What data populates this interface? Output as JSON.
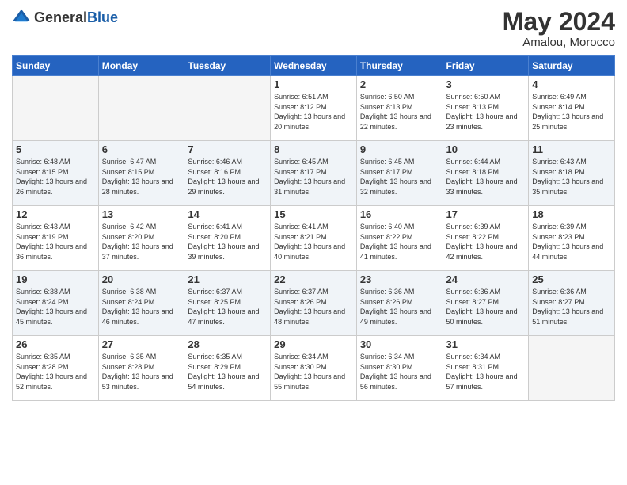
{
  "logo": {
    "general": "General",
    "blue": "Blue"
  },
  "title": {
    "month_year": "May 2024",
    "location": "Amalou, Morocco"
  },
  "weekdays": [
    "Sunday",
    "Monday",
    "Tuesday",
    "Wednesday",
    "Thursday",
    "Friday",
    "Saturday"
  ],
  "weeks": [
    [
      {
        "day": "",
        "info": ""
      },
      {
        "day": "",
        "info": ""
      },
      {
        "day": "",
        "info": ""
      },
      {
        "day": "1",
        "info": "Sunrise: 6:51 AM\nSunset: 8:12 PM\nDaylight: 13 hours and 20 minutes."
      },
      {
        "day": "2",
        "info": "Sunrise: 6:50 AM\nSunset: 8:13 PM\nDaylight: 13 hours and 22 minutes."
      },
      {
        "day": "3",
        "info": "Sunrise: 6:50 AM\nSunset: 8:13 PM\nDaylight: 13 hours and 23 minutes."
      },
      {
        "day": "4",
        "info": "Sunrise: 6:49 AM\nSunset: 8:14 PM\nDaylight: 13 hours and 25 minutes."
      }
    ],
    [
      {
        "day": "5",
        "info": "Sunrise: 6:48 AM\nSunset: 8:15 PM\nDaylight: 13 hours and 26 minutes."
      },
      {
        "day": "6",
        "info": "Sunrise: 6:47 AM\nSunset: 8:15 PM\nDaylight: 13 hours and 28 minutes."
      },
      {
        "day": "7",
        "info": "Sunrise: 6:46 AM\nSunset: 8:16 PM\nDaylight: 13 hours and 29 minutes."
      },
      {
        "day": "8",
        "info": "Sunrise: 6:45 AM\nSunset: 8:17 PM\nDaylight: 13 hours and 31 minutes."
      },
      {
        "day": "9",
        "info": "Sunrise: 6:45 AM\nSunset: 8:17 PM\nDaylight: 13 hours and 32 minutes."
      },
      {
        "day": "10",
        "info": "Sunrise: 6:44 AM\nSunset: 8:18 PM\nDaylight: 13 hours and 33 minutes."
      },
      {
        "day": "11",
        "info": "Sunrise: 6:43 AM\nSunset: 8:18 PM\nDaylight: 13 hours and 35 minutes."
      }
    ],
    [
      {
        "day": "12",
        "info": "Sunrise: 6:43 AM\nSunset: 8:19 PM\nDaylight: 13 hours and 36 minutes."
      },
      {
        "day": "13",
        "info": "Sunrise: 6:42 AM\nSunset: 8:20 PM\nDaylight: 13 hours and 37 minutes."
      },
      {
        "day": "14",
        "info": "Sunrise: 6:41 AM\nSunset: 8:20 PM\nDaylight: 13 hours and 39 minutes."
      },
      {
        "day": "15",
        "info": "Sunrise: 6:41 AM\nSunset: 8:21 PM\nDaylight: 13 hours and 40 minutes."
      },
      {
        "day": "16",
        "info": "Sunrise: 6:40 AM\nSunset: 8:22 PM\nDaylight: 13 hours and 41 minutes."
      },
      {
        "day": "17",
        "info": "Sunrise: 6:39 AM\nSunset: 8:22 PM\nDaylight: 13 hours and 42 minutes."
      },
      {
        "day": "18",
        "info": "Sunrise: 6:39 AM\nSunset: 8:23 PM\nDaylight: 13 hours and 44 minutes."
      }
    ],
    [
      {
        "day": "19",
        "info": "Sunrise: 6:38 AM\nSunset: 8:24 PM\nDaylight: 13 hours and 45 minutes."
      },
      {
        "day": "20",
        "info": "Sunrise: 6:38 AM\nSunset: 8:24 PM\nDaylight: 13 hours and 46 minutes."
      },
      {
        "day": "21",
        "info": "Sunrise: 6:37 AM\nSunset: 8:25 PM\nDaylight: 13 hours and 47 minutes."
      },
      {
        "day": "22",
        "info": "Sunrise: 6:37 AM\nSunset: 8:26 PM\nDaylight: 13 hours and 48 minutes."
      },
      {
        "day": "23",
        "info": "Sunrise: 6:36 AM\nSunset: 8:26 PM\nDaylight: 13 hours and 49 minutes."
      },
      {
        "day": "24",
        "info": "Sunrise: 6:36 AM\nSunset: 8:27 PM\nDaylight: 13 hours and 50 minutes."
      },
      {
        "day": "25",
        "info": "Sunrise: 6:36 AM\nSunset: 8:27 PM\nDaylight: 13 hours and 51 minutes."
      }
    ],
    [
      {
        "day": "26",
        "info": "Sunrise: 6:35 AM\nSunset: 8:28 PM\nDaylight: 13 hours and 52 minutes."
      },
      {
        "day": "27",
        "info": "Sunrise: 6:35 AM\nSunset: 8:28 PM\nDaylight: 13 hours and 53 minutes."
      },
      {
        "day": "28",
        "info": "Sunrise: 6:35 AM\nSunset: 8:29 PM\nDaylight: 13 hours and 54 minutes."
      },
      {
        "day": "29",
        "info": "Sunrise: 6:34 AM\nSunset: 8:30 PM\nDaylight: 13 hours and 55 minutes."
      },
      {
        "day": "30",
        "info": "Sunrise: 6:34 AM\nSunset: 8:30 PM\nDaylight: 13 hours and 56 minutes."
      },
      {
        "day": "31",
        "info": "Sunrise: 6:34 AM\nSunset: 8:31 PM\nDaylight: 13 hours and 57 minutes."
      },
      {
        "day": "",
        "info": ""
      }
    ]
  ]
}
